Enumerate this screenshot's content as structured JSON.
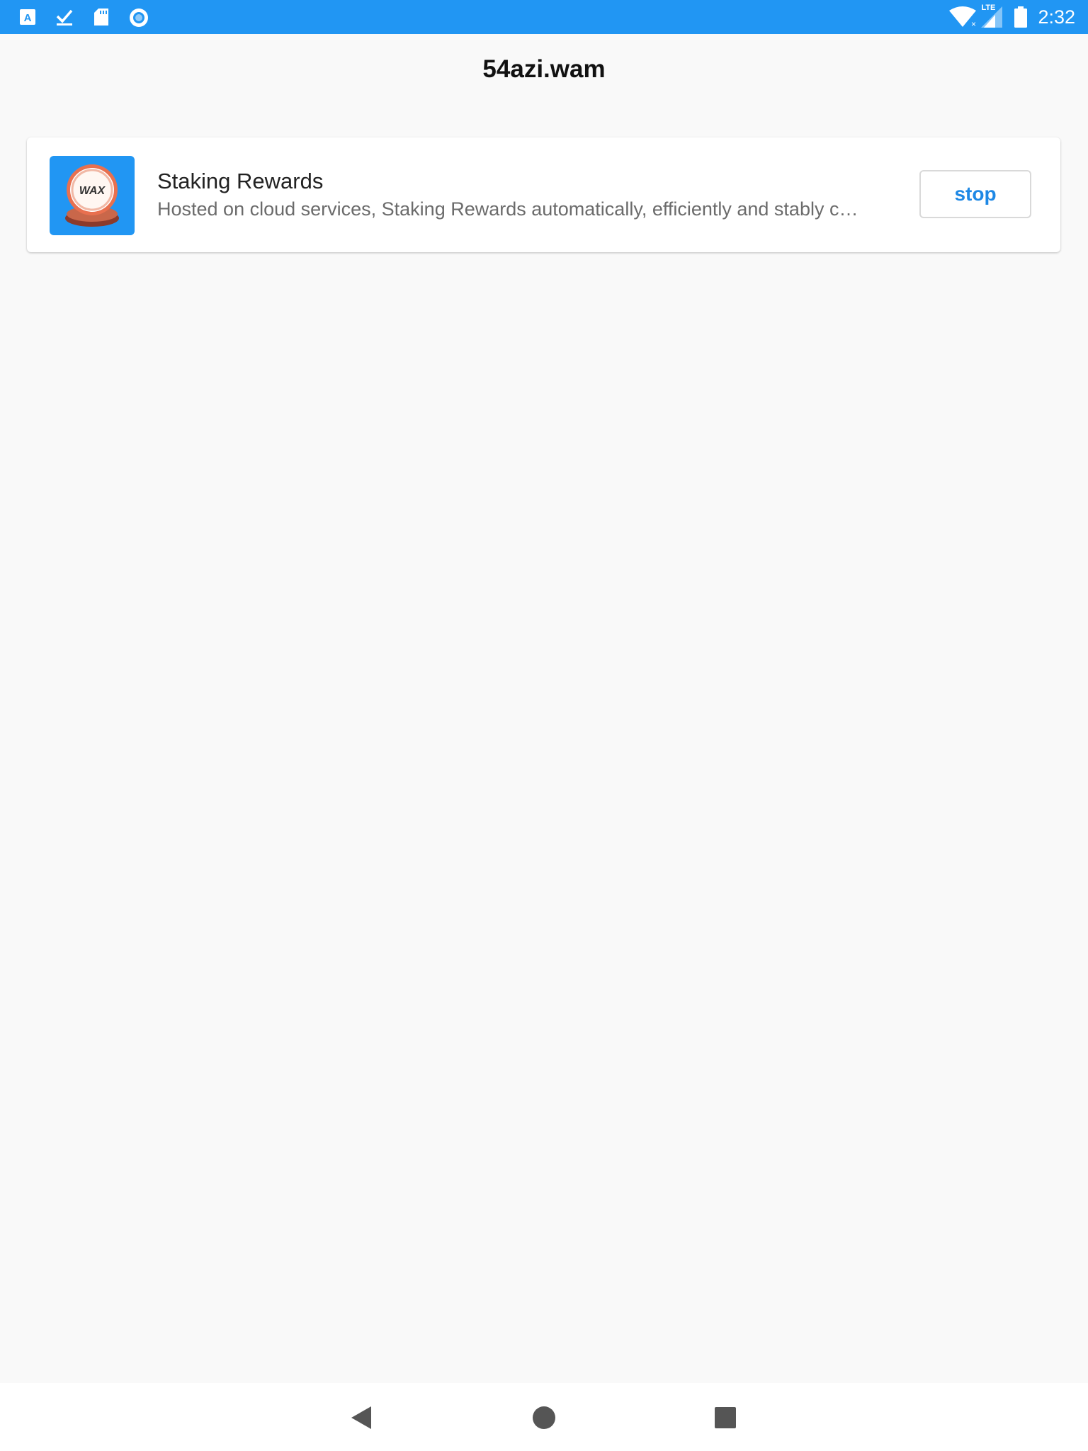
{
  "status_bar": {
    "time": "2:32",
    "network_label": "LTE",
    "left_icons": [
      "a-icon",
      "download-done-icon",
      "sd-card-icon",
      "sync-circle-icon"
    ],
    "right_icons": [
      "wifi-icon",
      "cellular-signal-icon",
      "battery-icon"
    ],
    "background_color": "#2196f3"
  },
  "header": {
    "title": "54azi.wam"
  },
  "services": [
    {
      "icon": "wax-logo",
      "title": "Staking Rewards",
      "description": "Hosted on cloud services, Staking Rewards automatically, efficiently and stably collects your staking rewards",
      "action_label": "stop",
      "action_color": "#1e88e5"
    }
  ],
  "nav_bar": {
    "buttons": [
      "back-icon",
      "home-icon",
      "recents-icon"
    ]
  }
}
